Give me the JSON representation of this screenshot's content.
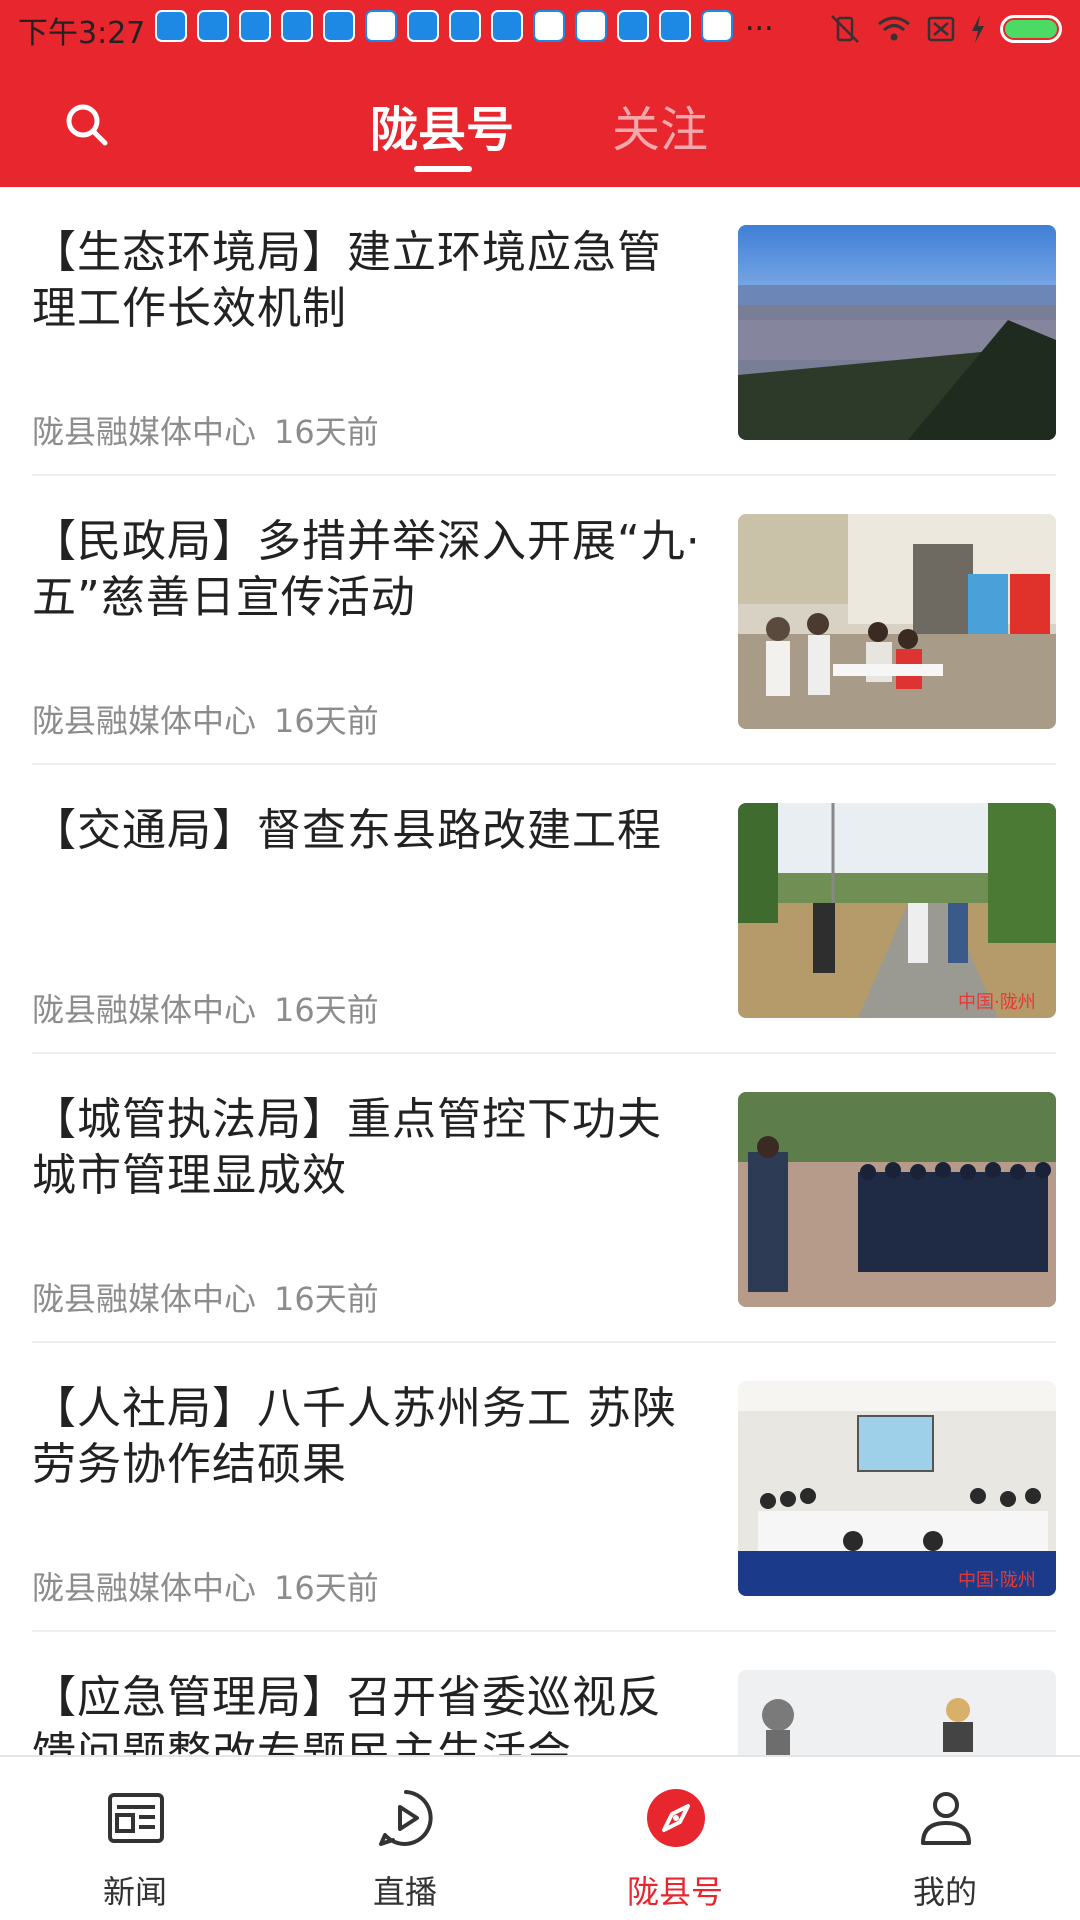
{
  "status_bar": {
    "time": "下午3:27",
    "app_icons": [
      "app-icon",
      "app-icon",
      "app-icon",
      "app-icon",
      "app-icon",
      "app-icon",
      "app-icon",
      "app-icon",
      "app-icon",
      "app-icon",
      "app-icon",
      "app-icon",
      "app-icon",
      "app-icon"
    ],
    "more": "...",
    "battery_color": "#4cd964"
  },
  "header": {
    "tabs": [
      {
        "label": "陇县号",
        "active": true
      },
      {
        "label": "关注",
        "active": false
      }
    ],
    "accent_color": "#e8262d"
  },
  "feed": {
    "items": [
      {
        "title": "【生态环境局】建立环境应急管理工作长效机制",
        "source": "陇县融媒体中心",
        "time": "16天前"
      },
      {
        "title": "【民政局】多措并举深入开展“九·五”慈善日宣传活动",
        "source": "陇县融媒体中心",
        "time": "16天前"
      },
      {
        "title": "【交通局】督查东县路改建工程",
        "source": "陇县融媒体中心",
        "time": "16天前"
      },
      {
        "title": "【城管执法局】重点管控下功夫城市管理显成效",
        "source": "陇县融媒体中心",
        "time": "16天前"
      },
      {
        "title": "【人社局】八千人苏州务工 苏陕劳务协作结硕果",
        "source": "陇县融媒体中心",
        "time": "16天前"
      },
      {
        "title": "【应急管理局】召开省委巡视反馈问题整改专题民主生活会",
        "source": "",
        "time": ""
      }
    ]
  },
  "bottom_nav": {
    "items": [
      {
        "label": "新闻",
        "icon": "newspaper-icon"
      },
      {
        "label": "直播",
        "icon": "play-icon"
      },
      {
        "label": "陇县号",
        "icon": "compass-icon",
        "active": true
      },
      {
        "label": "我的",
        "icon": "user-icon"
      }
    ]
  }
}
